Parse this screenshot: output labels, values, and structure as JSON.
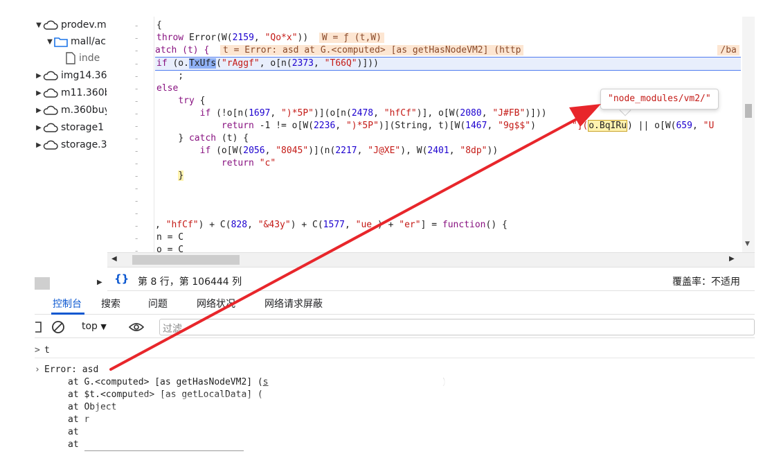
{
  "tree": {
    "items": [
      {
        "label": "prodev.m",
        "arrow": "▼",
        "kind": "cloud"
      },
      {
        "label": "mall/ac",
        "arrow": "▼",
        "kind": "folder"
      },
      {
        "label": "inde",
        "arrow": "",
        "kind": "file"
      },
      {
        "label": "img14.36",
        "arrow": "▶",
        "kind": "cloud"
      },
      {
        "label": "m11.360b",
        "arrow": "▶",
        "kind": "cloud"
      },
      {
        "label": "m.360buy",
        "arrow": "▶",
        "kind": "cloud"
      },
      {
        "label": "storage1",
        "arrow": "▶",
        "kind": "cloud"
      },
      {
        "label": "storage.3",
        "arrow": "▶",
        "kind": "cloud"
      }
    ]
  },
  "code": {
    "gutter_marker": "-",
    "line1": "{",
    "line2": {
      "kw": "throw",
      "a": " Error(W(",
      "n": "2159",
      "b": ", ",
      "s": "\"Qo*x\"",
      "c": "))",
      "inline": "W = ƒ (t,W)"
    },
    "line3": {
      "a": "atch (t) {",
      "inline": "t = Error: asd at G.<computed> [as getHasNodeVM2] (http",
      "inline_tail": "/ba"
    },
    "line4": {
      "kw": "if",
      "a": " (o.",
      "sel": "TxUfs",
      "b": "(",
      "s1": "\"rAggf\"",
      "c": ", o[n(",
      "n": "2373",
      "d": ", ",
      "s2": "\"T66Q\"",
      "e": ")]))"
    },
    "line5": "    ;",
    "line6": "else",
    "line7": {
      "kw": "try",
      "a": " {"
    },
    "line8": {
      "kw": "if",
      "a": " (!o[n(",
      "n1": "1697",
      "b": ", ",
      "s1": "\")*5P\"",
      "c": ")](o[n(",
      "n2": "2478",
      "d": ", ",
      "s2": "\"hfCf\"",
      "e": ")], o[W(",
      "n3": "2080",
      "f": ", ",
      "s3": "\"J#FB\"",
      "g": ")]))"
    },
    "line9": {
      "kw": "return",
      "a": " -1 != o[W(",
      "n1": "2236",
      "b": ", ",
      "s1": "\")*5P\"",
      "c": ")](String, t)[W(",
      "n2": "1467",
      "d": ", ",
      "s2": "\"9g$$\"",
      "e": ") ",
      "f": "\"](",
      "box": "o.BqIRu",
      "g": ") || o[W(",
      "n3": "659",
      "h": ", ",
      "s3": "\"U"
    },
    "line10": {
      "a": "} ",
      "kw": "catch",
      "b": " (t) {"
    },
    "line11": {
      "kw": "if",
      "a": " (o[W(",
      "n1": "2056",
      "b": ", ",
      "s1": "\"8045\"",
      "c": ")](n(",
      "n2": "2217",
      "d": ", ",
      "s2": "\"J@XE\"",
      "e": "), W(",
      "n3": "2401",
      "f": ", ",
      "s3": "\"8dp\"",
      "g": "))"
    },
    "line12": {
      "kw": "return",
      "s": " \"c\""
    },
    "line13": "}",
    "line17": {
      "a": ", ",
      "s1": "\"hfCf\"",
      "b": ") + C(",
      "n1": "828",
      "c": ", ",
      "s2": "\"&43y\"",
      "d": ") + C(",
      "n2": "1577",
      "e": ", ",
      "s3": "\"ue",
      "f": " ) + ",
      "s4": "\"er\"",
      "g": "] = ",
      "kw": "function",
      "h": "() {"
    },
    "line18": "n = C",
    "line19": "o = C"
  },
  "tooltip": {
    "text": "\"node_modules/vm2/\""
  },
  "status": {
    "position": "第 8 行，第 106444 列",
    "coverage": "覆盖率：不适用",
    "format_icon": "{}"
  },
  "tabs": [
    "控制台",
    "搜索",
    "问题",
    "网络状况",
    "网络请求屏蔽"
  ],
  "console_toolbar": {
    "context": "top",
    "filter_placeholder": "过滤"
  },
  "console": {
    "input_prompt": ">",
    "input": "t",
    "error_head": "Error: asd",
    "stack": [
      {
        "a": "at G.<computed> [as getHasNodeVM2] (",
        "b": "s",
        "tail": ")"
      },
      {
        "a": "at $t.<computed> [as getLocalData] (",
        "b": "",
        "tail": ""
      },
      {
        "a": "at Object",
        "b": "",
        "tail": ""
      },
      {
        "a": "at r",
        "b": "",
        "tail": ""
      },
      {
        "a": "at",
        "b": "",
        "tail": ""
      },
      {
        "a": "at",
        "b": "",
        "tail": ""
      }
    ]
  },
  "colors": {
    "accent": "#0b57d0",
    "arrow": "#e8262b",
    "string": "#c41a16",
    "keyword": "#881280",
    "number": "#1c00cf"
  }
}
